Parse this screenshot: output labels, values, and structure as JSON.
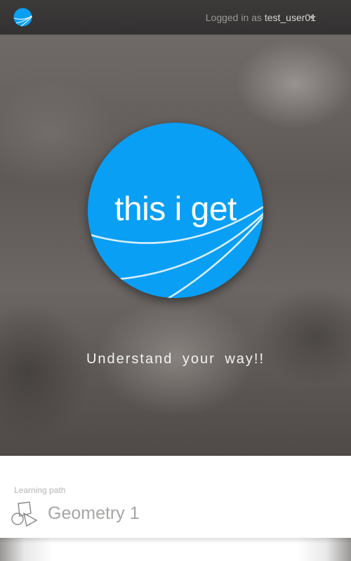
{
  "header": {
    "logged_in_prefix": "Logged in as ",
    "username": "test_user01",
    "logo_icon": "this-i-get-globe-icon",
    "menu_icon": "caret-down-icon"
  },
  "hero": {
    "brand_text": "this i get",
    "tagline": "Understand your way!!"
  },
  "learning_path": {
    "section_label": "Learning path",
    "item_title": "Geometry 1",
    "item_icon": "geometry-shapes-icon"
  },
  "colors": {
    "brand_blue": "#099ff5",
    "topbar": "#383635",
    "muted_text": "#a8a6a4"
  }
}
